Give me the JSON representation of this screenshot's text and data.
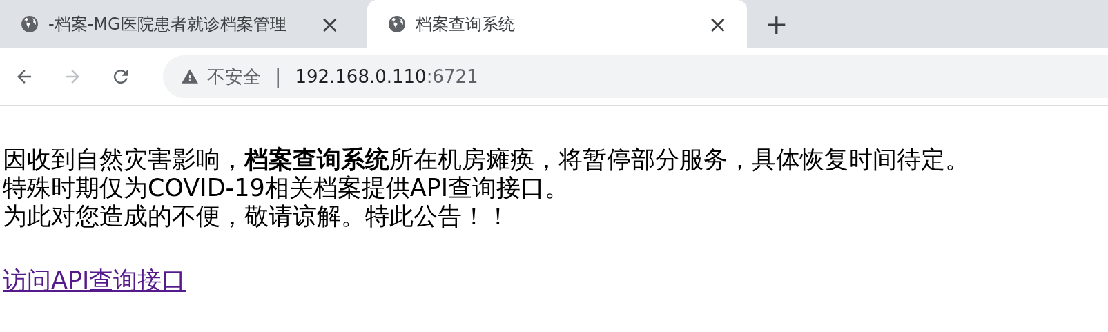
{
  "tabs": [
    {
      "title": "-档案-MG医院患者就诊档案管理",
      "selected": false,
      "close": "×"
    },
    {
      "title": "档案查询系统",
      "selected": true,
      "close": "×"
    }
  ],
  "new_tab": "+",
  "address_bar": {
    "security": "不安全",
    "separator": "|",
    "host": "192.168.0.110",
    "port": ":6721"
  },
  "page": {
    "lines": [
      "因收到自然灾害影响，**档案查询系统**所在机房瘫痪，将暂停部分服务，具体恢复时间待定。",
      "特殊时期仅为COVID-19相关档案提供API查询接口。",
      "为此对您造成的不便，敬请谅解。特此公告！！"
    ],
    "link": {
      "text": "访问API查询接口",
      "visited": true
    }
  }
}
